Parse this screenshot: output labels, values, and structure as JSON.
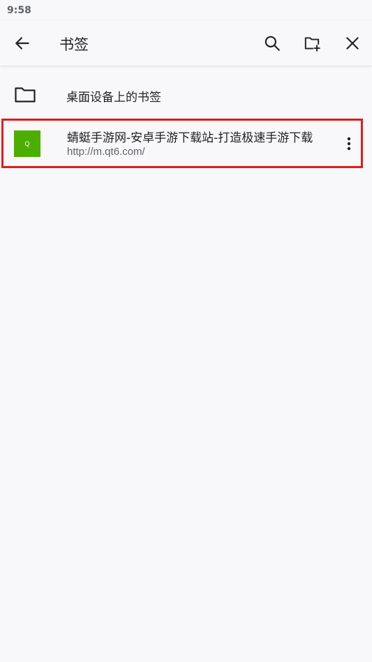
{
  "status_bar": {
    "time": "9:58"
  },
  "app_bar": {
    "title": "书签",
    "icons": {
      "back": "arrow-back-icon",
      "search": "search-icon",
      "add_folder": "add-folder-icon",
      "close": "close-icon"
    }
  },
  "list": {
    "folder": {
      "label": "桌面设备上的书签",
      "icon": "folder-icon"
    },
    "bookmarks": [
      {
        "title": "蜻蜓手游网-安卓手游下载站-打造极速手游下载",
        "url": "http://m.qt6.com/",
        "favicon_letter": "Q",
        "favicon_color": "#4caf00",
        "highlight_color": "#e31b1b"
      }
    ]
  }
}
